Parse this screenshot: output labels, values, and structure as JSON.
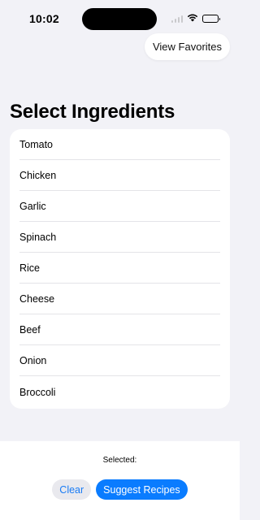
{
  "status_bar": {
    "time": "10:02",
    "icons": [
      "signal-icon",
      "wifi-icon",
      "battery-icon"
    ]
  },
  "header": {
    "favorites_label": "View Favorites",
    "title": "Select Ingredients"
  },
  "ingredients": [
    {
      "label": "Tomato"
    },
    {
      "label": "Chicken"
    },
    {
      "label": "Garlic"
    },
    {
      "label": "Spinach"
    },
    {
      "label": "Rice"
    },
    {
      "label": "Cheese"
    },
    {
      "label": "Beef"
    },
    {
      "label": "Onion"
    },
    {
      "label": "Broccoli"
    }
  ],
  "footer": {
    "selected_label": "Selected:",
    "clear_label": "Clear",
    "suggest_label": "Suggest Recipes"
  },
  "colors": {
    "background": "#f2f2f7",
    "accent": "#0a7cff",
    "card": "#ffffff"
  }
}
